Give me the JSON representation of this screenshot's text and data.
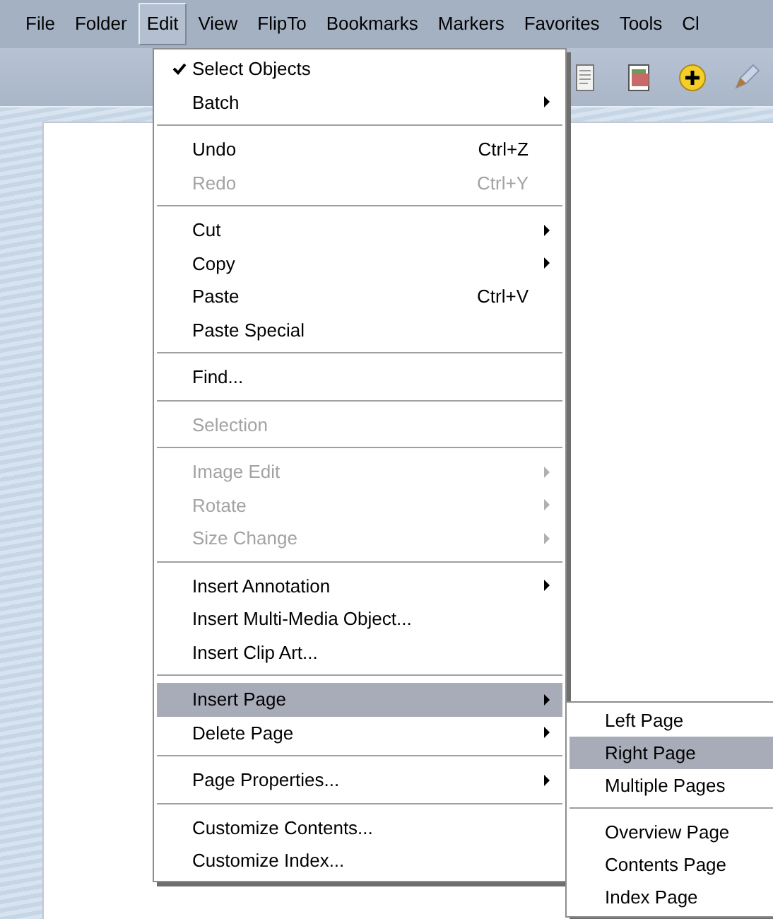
{
  "menu_bar": [
    {
      "label": "File",
      "selected": false
    },
    {
      "label": "Folder",
      "selected": false
    },
    {
      "label": "Edit",
      "selected": true
    },
    {
      "label": "View",
      "selected": false
    },
    {
      "label": "FlipTo",
      "selected": false
    },
    {
      "label": "Bookmarks",
      "selected": false
    },
    {
      "label": "Markers",
      "selected": false
    },
    {
      "label": "Favorites",
      "selected": false
    },
    {
      "label": "Tools",
      "selected": false
    },
    {
      "label": "Cl",
      "selected": false
    }
  ],
  "edit_menu": {
    "items": [
      {
        "kind": "item",
        "label": "Select Objects",
        "checked": true,
        "disabled": false,
        "submenu": false,
        "selected": false
      },
      {
        "kind": "item",
        "label": "Batch",
        "checked": false,
        "disabled": false,
        "submenu": true,
        "selected": false
      },
      {
        "kind": "separator"
      },
      {
        "kind": "item",
        "label": "Undo",
        "shortcut": "Ctrl+Z",
        "checked": false,
        "disabled": false,
        "submenu": false,
        "selected": false
      },
      {
        "kind": "item",
        "label": "Redo",
        "shortcut": "Ctrl+Y",
        "checked": false,
        "disabled": true,
        "submenu": false,
        "selected": false
      },
      {
        "kind": "separator"
      },
      {
        "kind": "item",
        "label": "Cut",
        "checked": false,
        "disabled": false,
        "submenu": true,
        "selected": false
      },
      {
        "kind": "item",
        "label": "Copy",
        "checked": false,
        "disabled": false,
        "submenu": true,
        "selected": false
      },
      {
        "kind": "item",
        "label": "Paste",
        "shortcut": "Ctrl+V",
        "checked": false,
        "disabled": false,
        "submenu": false,
        "selected": false
      },
      {
        "kind": "item",
        "label": "Paste Special",
        "checked": false,
        "disabled": false,
        "submenu": false,
        "selected": false
      },
      {
        "kind": "separator"
      },
      {
        "kind": "item",
        "label": "Find...",
        "checked": false,
        "disabled": false,
        "submenu": false,
        "selected": false
      },
      {
        "kind": "separator"
      },
      {
        "kind": "item",
        "label": "Selection",
        "checked": false,
        "disabled": true,
        "submenu": false,
        "selected": false
      },
      {
        "kind": "separator"
      },
      {
        "kind": "item",
        "label": "Image Edit",
        "checked": false,
        "disabled": true,
        "submenu": true,
        "selected": false
      },
      {
        "kind": "item",
        "label": "Rotate",
        "checked": false,
        "disabled": true,
        "submenu": true,
        "selected": false
      },
      {
        "kind": "item",
        "label": "Size Change",
        "checked": false,
        "disabled": true,
        "submenu": true,
        "selected": false
      },
      {
        "kind": "separator"
      },
      {
        "kind": "item",
        "label": "Insert Annotation",
        "checked": false,
        "disabled": false,
        "submenu": true,
        "selected": false
      },
      {
        "kind": "item",
        "label": "Insert Multi-Media Object...",
        "checked": false,
        "disabled": false,
        "submenu": false,
        "selected": false
      },
      {
        "kind": "item",
        "label": "Insert Clip Art...",
        "checked": false,
        "disabled": false,
        "submenu": false,
        "selected": false
      },
      {
        "kind": "separator"
      },
      {
        "kind": "item",
        "label": "Insert Page",
        "checked": false,
        "disabled": false,
        "submenu": true,
        "selected": true
      },
      {
        "kind": "item",
        "label": "Delete Page",
        "checked": false,
        "disabled": false,
        "submenu": true,
        "selected": false
      },
      {
        "kind": "separator"
      },
      {
        "kind": "item",
        "label": "Page Properties...",
        "checked": false,
        "disabled": false,
        "submenu": true,
        "selected": false
      },
      {
        "kind": "separator"
      },
      {
        "kind": "item",
        "label": "Customize Contents...",
        "checked": false,
        "disabled": false,
        "submenu": false,
        "selected": false
      },
      {
        "kind": "item",
        "label": "Customize Index...",
        "checked": false,
        "disabled": false,
        "submenu": false,
        "selected": false
      }
    ]
  },
  "insert_page_submenu": {
    "items": [
      {
        "kind": "item",
        "label": "Left Page",
        "disabled": false,
        "selected": false
      },
      {
        "kind": "item",
        "label": "Right Page",
        "disabled": false,
        "selected": true
      },
      {
        "kind": "item",
        "label": "Multiple Pages",
        "disabled": false,
        "selected": false
      },
      {
        "kind": "separator"
      },
      {
        "kind": "item",
        "label": "Overview Page",
        "disabled": false,
        "selected": false
      },
      {
        "kind": "item",
        "label": "Contents Page",
        "disabled": false,
        "selected": false
      },
      {
        "kind": "item",
        "label": "Index Page",
        "disabled": false,
        "selected": false
      }
    ]
  }
}
